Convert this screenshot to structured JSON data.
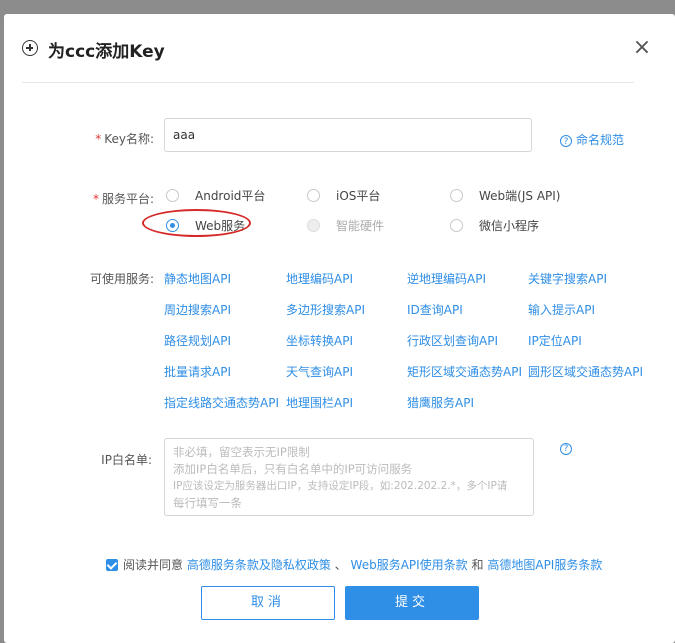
{
  "dialog": {
    "title": "为ccc添加Key",
    "close_icon": "×"
  },
  "form": {
    "key_name": {
      "required_mark": "*",
      "label": "Key名称:",
      "value": "aaa",
      "help_text": "命名规范"
    },
    "service_platform": {
      "required_mark": "*",
      "label": "服务平台:",
      "options": [
        {
          "label": "Android平台",
          "checked": false,
          "disabled": false
        },
        {
          "label": "iOS平台",
          "checked": false,
          "disabled": false
        },
        {
          "label": "Web端(JS API)",
          "checked": false,
          "disabled": false
        },
        {
          "label": "Web服务",
          "checked": true,
          "disabled": false
        },
        {
          "label": "智能硬件",
          "checked": false,
          "disabled": true
        },
        {
          "label": "微信小程序",
          "checked": false,
          "disabled": false
        }
      ]
    },
    "available_services": {
      "label": "可使用服务:",
      "apis": [
        "静态地图API",
        "地理编码API",
        "逆地理编码API",
        "关键字搜索API",
        "周边搜索API",
        "多边形搜索API",
        "ID查询API",
        "输入提示API",
        "路径规划API",
        "坐标转换API",
        "行政区划查询API",
        "IP定位API",
        "批量请求API",
        "天气查询API",
        "矩形区域交通态势API",
        "圆形区域交通态势API",
        "指定线路交通态势API",
        "地理围栏API",
        "猎鹰服务API"
      ]
    },
    "ip_whitelist": {
      "label": "IP白名单:",
      "placeholder_lines": [
        "非必填，留空表示无IP限制",
        "添加IP白名单后，只有白名单中的IP可访问服务",
        "IP应该设定为服务器出口IP，支持设定IP段，如:202.202.2.*，多个IP请",
        "每行填写一条"
      ]
    }
  },
  "agreement": {
    "checked": true,
    "prefix": "阅读并同意",
    "link1": "高德服务条款及隐私权政策",
    "sep1": "、",
    "link2": "Web服务API使用条款",
    "sep2": "和",
    "link3": "高德地图API服务条款"
  },
  "buttons": {
    "cancel": "取消",
    "submit": "提交"
  }
}
